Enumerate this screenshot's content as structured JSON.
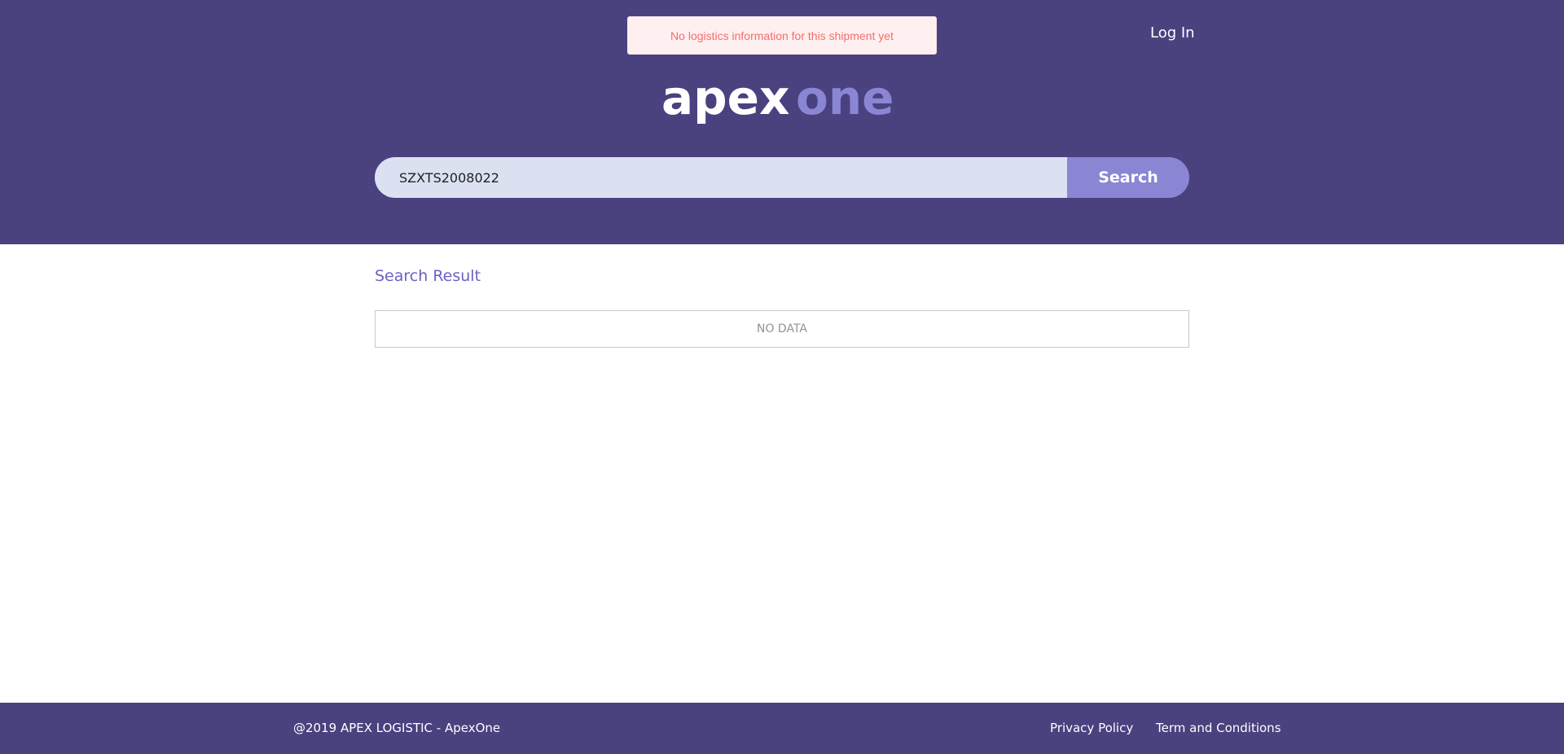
{
  "toast": {
    "message": "No logistics information for this shipment yet"
  },
  "header": {
    "login_label": "Log In",
    "logo": {
      "part1": "apex",
      "part2": "one"
    }
  },
  "search": {
    "value": "SZXTS2008022",
    "button_label": "Search"
  },
  "results": {
    "title": "Search Result",
    "empty_text": "NO DATA"
  },
  "footer": {
    "copyright": "@2019 APEX LOGISTIC - ApexOne",
    "privacy_label": "Privacy Policy",
    "terms_label": "Term and Conditions"
  },
  "colors": {
    "header_bg": "#4a417f",
    "accent": "#8a86d4",
    "input_bg": "#dce1f2",
    "toast_text": "#f56c6c"
  }
}
